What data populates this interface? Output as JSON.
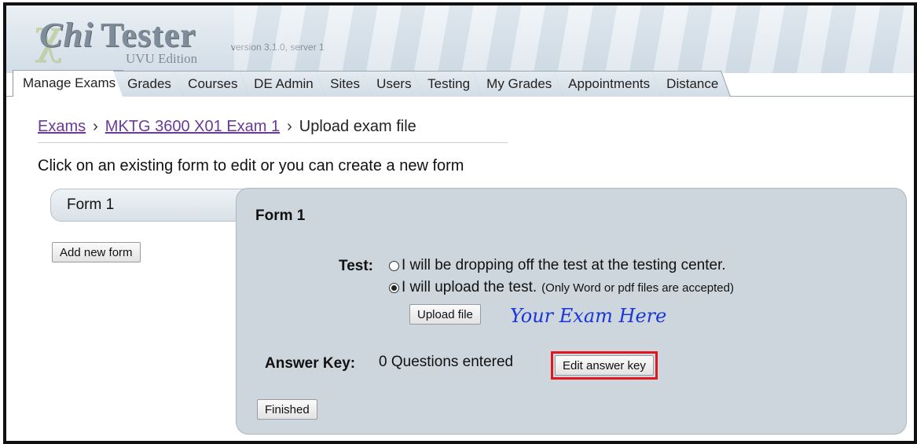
{
  "app": {
    "logo_chi": "Chi",
    "logo_tester": "Tester",
    "version": "version 3.1.0, server 1",
    "edition": "UVU Edition"
  },
  "tabs": [
    {
      "label": "Manage Exams",
      "active": true
    },
    {
      "label": "Grades"
    },
    {
      "label": "Courses"
    },
    {
      "label": "DE Admin"
    },
    {
      "label": "Sites"
    },
    {
      "label": "Users"
    },
    {
      "label": "Testing"
    },
    {
      "label": "My Grades"
    },
    {
      "label": "Appointments"
    },
    {
      "label": "Distance"
    }
  ],
  "breadcrumb": {
    "exams": "Exams",
    "exam": "MKTG 3600 X01 Exam 1",
    "current": "Upload exam file",
    "separator": "›"
  },
  "instructions": "Click on an existing form to edit or you can create a new form",
  "sidebar": {
    "form_tab": "Form 1",
    "add_button": "Add new form"
  },
  "panel": {
    "title": "Form 1",
    "test_label": "Test:",
    "option_dropoff": "I will be dropping off the test at the testing center.",
    "option_upload": "I will upload the test.",
    "upload_note": "(Only Word or pdf files are accepted)",
    "selected_option": "upload",
    "upload_button": "Upload file",
    "exam_note": "Your Exam Here",
    "answer_key_label": "Answer Key:",
    "answer_key_value": "0 Questions entered",
    "edit_answer_key_button": "Edit answer key",
    "finished_button": "Finished"
  },
  "colors": {
    "highlight": "#e0161f",
    "annotation": "#1a35d8",
    "link": "#6a3a9a",
    "panel_bg": "#cdd6dd"
  }
}
